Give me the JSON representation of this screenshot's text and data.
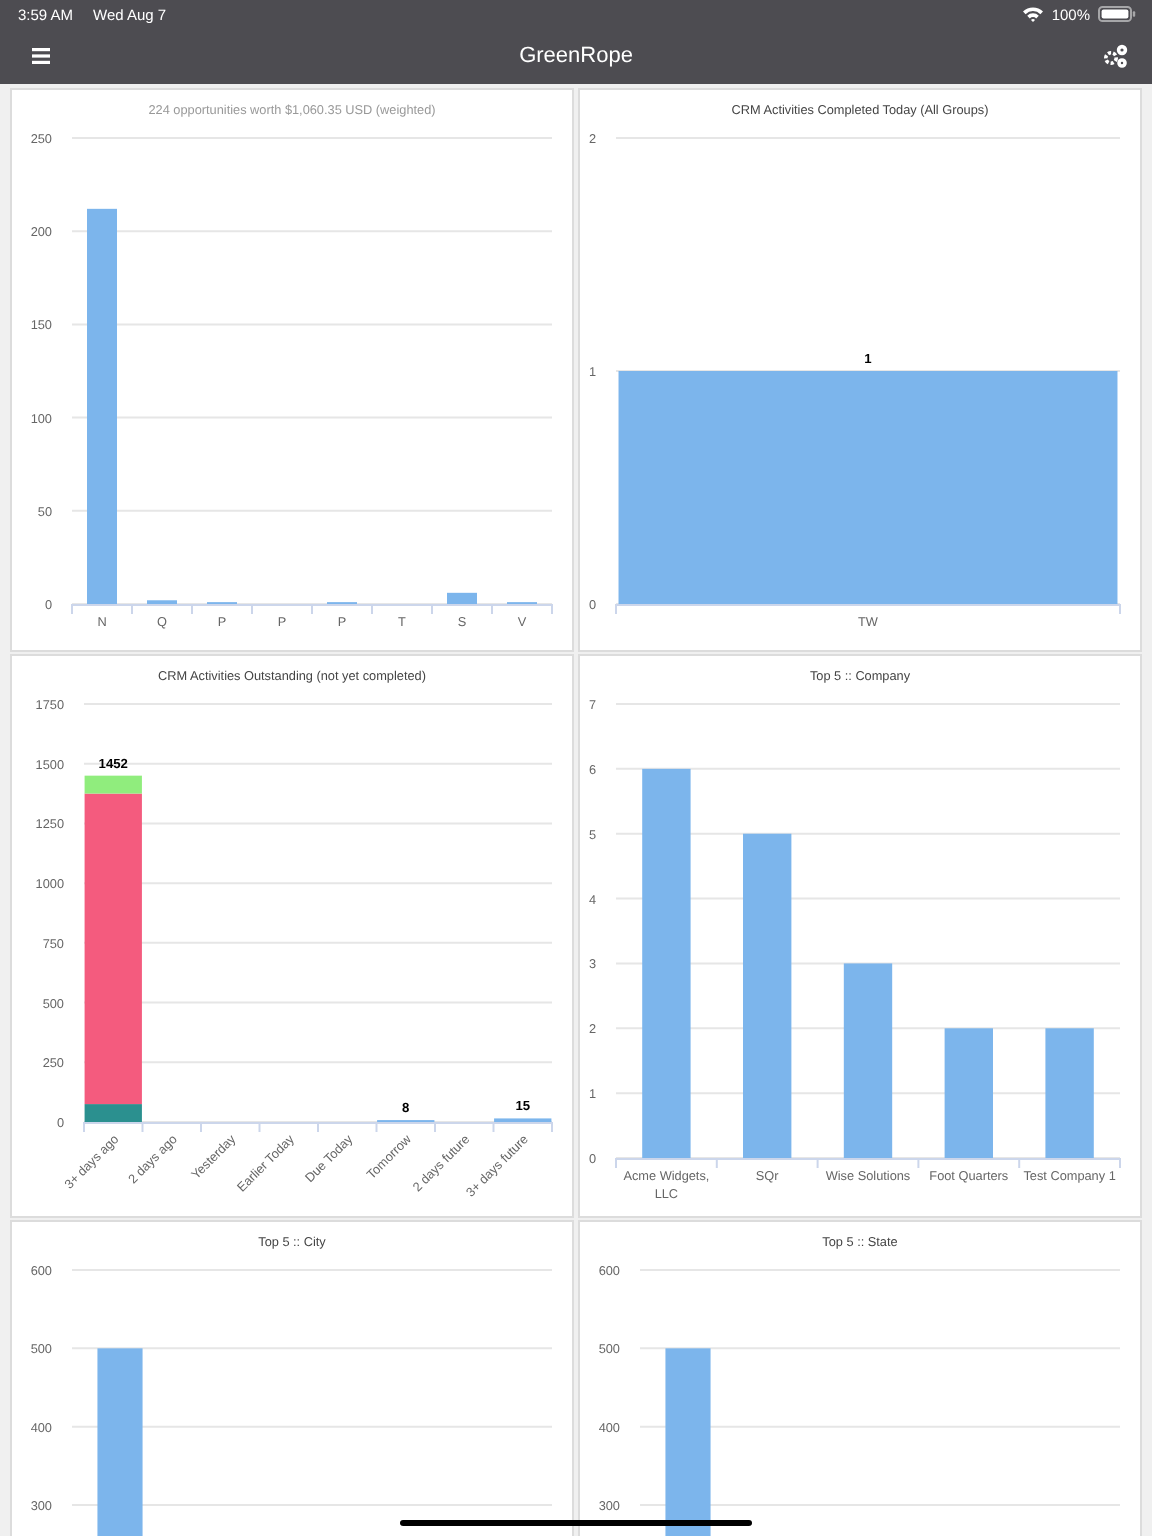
{
  "status_bar": {
    "time": "3:59 AM",
    "date": "Wed Aug 7",
    "battery": "100%"
  },
  "nav_bar": {
    "title": "GreenRope"
  },
  "charts": [
    {
      "chart_data": {
        "type": "bar",
        "title": "224 opportunities worth $1,060.35 USD (weighted)",
        "categories": [
          "N",
          "Q",
          "P",
          "P",
          "P",
          "T",
          "S",
          "V"
        ],
        "values": [
          212,
          2,
          1,
          0,
          1,
          0,
          6,
          1
        ],
        "ylim": [
          0,
          250
        ],
        "yticks": [
          0,
          50,
          100,
          150,
          200,
          250
        ],
        "grid": true
      }
    },
    {
      "chart_data": {
        "type": "bar",
        "title": "CRM Activities Completed Today (All Groups)",
        "categories": [
          "TW"
        ],
        "values": [
          1
        ],
        "ylim": [
          0,
          2
        ],
        "yticks": [
          0,
          1,
          2
        ],
        "data_labels": true,
        "grid": true
      }
    },
    {
      "chart_data": {
        "type": "bar",
        "title": "CRM Activities Outstanding (not yet completed)",
        "categories": [
          "3+ days ago",
          "2 days ago",
          "Yesterday",
          "Earlier Today",
          "Due Today",
          "Tomorrow",
          "2 days future",
          "3+ days future"
        ],
        "stacked": true,
        "grid": true,
        "ylim": [
          0,
          1750
        ],
        "yticks": [
          0,
          250,
          500,
          750,
          1000,
          1250,
          1500,
          1750
        ],
        "value_labels": [
          "1452",
          null,
          null,
          null,
          null,
          "8",
          null,
          "15"
        ],
        "series": [
          {
            "color": "#2b908f",
            "values": [
              75,
              null,
              null,
              null,
              null,
              null,
              null,
              null
            ]
          },
          {
            "color": "#f45b7e",
            "values": [
              1300,
              null,
              null,
              null,
              null,
              null,
              null,
              null
            ]
          },
          {
            "color": "#90ed7d",
            "values": [
              75,
              null,
              null,
              null,
              null,
              null,
              null,
              null
            ]
          },
          {
            "color": "#7cb5ec",
            "values": [
              null,
              null,
              null,
              null,
              null,
              8,
              null,
              15
            ]
          }
        ]
      }
    },
    {
      "chart_data": {
        "type": "bar",
        "title": "Top 5 :: Company",
        "categories": [
          "Acme Widgets, LLC",
          "SQr",
          "Wise Solutions",
          "Foot Quarters",
          "Test Company 1"
        ],
        "values": [
          6,
          5,
          3,
          2,
          2
        ],
        "ylim": [
          0,
          7
        ],
        "yticks": [
          0,
          1,
          2,
          3,
          4,
          5,
          6,
          7
        ],
        "grid": true
      }
    },
    {
      "chart_data": {
        "type": "bar",
        "title": "Top 5 :: City",
        "values": [
          500
        ],
        "ylim": [
          0,
          600
        ],
        "yticks": [
          300,
          400,
          500,
          600
        ],
        "grid": true
      }
    },
    {
      "chart_data": {
        "type": "bar",
        "title": "Top 5 :: State",
        "values": [
          500
        ],
        "ylim": [
          0,
          600
        ],
        "yticks": [
          300,
          400,
          500,
          600
        ],
        "grid": true
      }
    }
  ]
}
